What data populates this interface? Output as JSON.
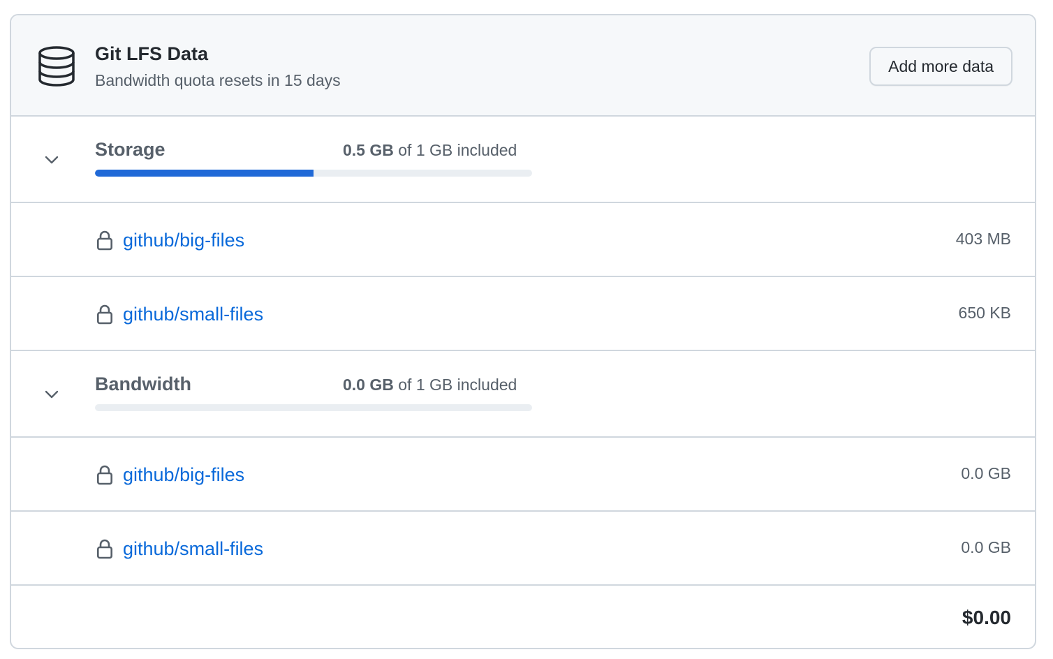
{
  "header": {
    "icon": "database-icon",
    "title": "Git LFS Data",
    "subtitle": "Bandwidth quota resets in 15 days",
    "add_button_label": "Add more data"
  },
  "storage": {
    "title": "Storage",
    "used": "0.5 GB",
    "of_text": " of 1 GB included",
    "usage_fraction": 0.5,
    "bar_color": "#2069d7",
    "repos": [
      {
        "name": "github/big-files",
        "size": "403 MB",
        "private": true
      },
      {
        "name": "github/small-files",
        "size": "650 KB",
        "private": true
      }
    ]
  },
  "bandwidth": {
    "title": "Bandwidth",
    "used": "0.0 GB",
    "of_text": " of 1 GB included",
    "usage_fraction": 0.0,
    "repos": [
      {
        "name": "github/big-files",
        "size": "0.0 GB",
        "private": true
      },
      {
        "name": "github/small-files",
        "size": "0.0 GB",
        "private": true
      }
    ]
  },
  "total": "$0.00",
  "colors": {
    "link": "#0969da",
    "border": "#d0d7de",
    "header_bg": "#f6f8fa"
  }
}
